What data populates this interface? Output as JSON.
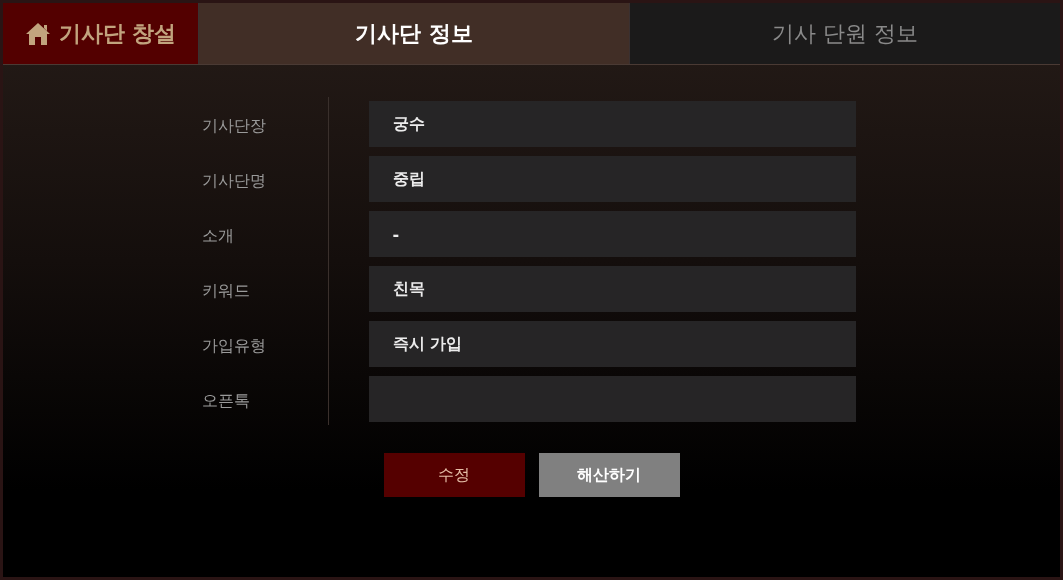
{
  "tabs": [
    {
      "label": "기사단 창설",
      "kind": "home",
      "selected": false
    },
    {
      "label": "기사단 정보",
      "kind": "tab",
      "selected": true
    },
    {
      "label": "기사 단원 정보",
      "kind": "tab",
      "selected": false
    }
  ],
  "fields": [
    {
      "label": "기사단장",
      "value": "궁수"
    },
    {
      "label": "기사단명",
      "value": "중립"
    },
    {
      "label": "소개",
      "value": "-"
    },
    {
      "label": "키워드",
      "value": "친목"
    },
    {
      "label": "가입유형",
      "value": "즉시 가입"
    },
    {
      "label": "오픈톡"
    }
  ],
  "buttons": [
    {
      "label": "수정",
      "kind": "primary"
    },
    {
      "label": "해산하기",
      "kind": "secondary"
    }
  ]
}
